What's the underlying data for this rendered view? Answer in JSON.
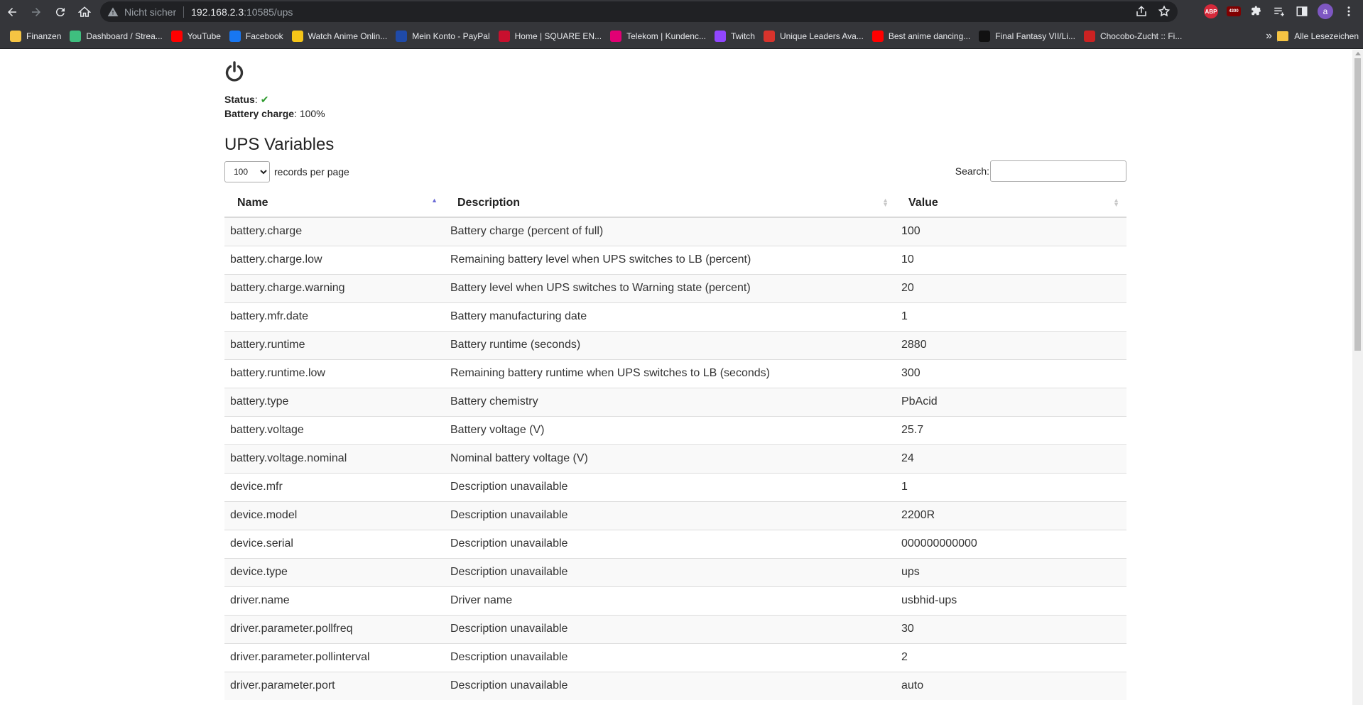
{
  "browser": {
    "insecure_label": "Nicht sicher",
    "url_host": "192.168.2.3",
    "url_path": ":10585/ups",
    "avatar_letter": "a",
    "abp_label": "ABP",
    "ext2_label": "4300"
  },
  "bookmarks": {
    "items": [
      {
        "label": "Finanzen",
        "icon_color": "#f6c443"
      },
      {
        "label": "Dashboard / Strea...",
        "icon_color": "#3fbf7f"
      },
      {
        "label": "YouTube",
        "icon_color": "#ff0000"
      },
      {
        "label": "Facebook",
        "icon_color": "#1877f2"
      },
      {
        "label": "Watch Anime Onlin...",
        "icon_color": "#f5c518"
      },
      {
        "label": "Mein Konto - PayPal",
        "icon_color": "#1f4aa8"
      },
      {
        "label": "Home | SQUARE EN...",
        "icon_color": "#c8102e"
      },
      {
        "label": "Telekom | Kundenc...",
        "icon_color": "#e20074"
      },
      {
        "label": "Twitch",
        "icon_color": "#9146ff"
      },
      {
        "label": "Unique Leaders Ava...",
        "icon_color": "#d8332c"
      },
      {
        "label": "Best anime dancing...",
        "icon_color": "#ff0000"
      },
      {
        "label": "Final Fantasy VII/Li...",
        "icon_color": "#111111"
      },
      {
        "label": "Chocobo-Zucht :: Fi...",
        "icon_color": "#cc2222"
      }
    ],
    "more_label": "»",
    "all_label": "Alle Lesezeichen"
  },
  "page": {
    "status_label": "Status",
    "status_value": "✔",
    "charge_label": "Battery charge",
    "charge_value": "100%",
    "title": "UPS Variables",
    "length_value": "100",
    "length_suffix": "records per page",
    "search_label": "Search:",
    "search_value": ""
  },
  "table": {
    "headers": [
      "Name",
      "Description",
      "Value"
    ],
    "rows": [
      {
        "name": "battery.charge",
        "desc": "Battery charge (percent of full)",
        "value": "100"
      },
      {
        "name": "battery.charge.low",
        "desc": "Remaining battery level when UPS switches to LB (percent)",
        "value": "10"
      },
      {
        "name": "battery.charge.warning",
        "desc": "Battery level when UPS switches to Warning state (percent)",
        "value": "20"
      },
      {
        "name": "battery.mfr.date",
        "desc": "Battery manufacturing date",
        "value": "1"
      },
      {
        "name": "battery.runtime",
        "desc": "Battery runtime (seconds)",
        "value": "2880"
      },
      {
        "name": "battery.runtime.low",
        "desc": "Remaining battery runtime when UPS switches to LB (seconds)",
        "value": "300"
      },
      {
        "name": "battery.type",
        "desc": "Battery chemistry",
        "value": "PbAcid"
      },
      {
        "name": "battery.voltage",
        "desc": "Battery voltage (V)",
        "value": "25.7"
      },
      {
        "name": "battery.voltage.nominal",
        "desc": "Nominal battery voltage (V)",
        "value": "24"
      },
      {
        "name": "device.mfr",
        "desc": "Description unavailable",
        "value": "1"
      },
      {
        "name": "device.model",
        "desc": "Description unavailable",
        "value": "2200R"
      },
      {
        "name": "device.serial",
        "desc": "Description unavailable",
        "value": "000000000000"
      },
      {
        "name": "device.type",
        "desc": "Description unavailable",
        "value": "ups"
      },
      {
        "name": "driver.name",
        "desc": "Driver name",
        "value": "usbhid-ups"
      },
      {
        "name": "driver.parameter.pollfreq",
        "desc": "Description unavailable",
        "value": "30"
      },
      {
        "name": "driver.parameter.pollinterval",
        "desc": "Description unavailable",
        "value": "2"
      },
      {
        "name": "driver.parameter.port",
        "desc": "Description unavailable",
        "value": "auto"
      }
    ]
  }
}
